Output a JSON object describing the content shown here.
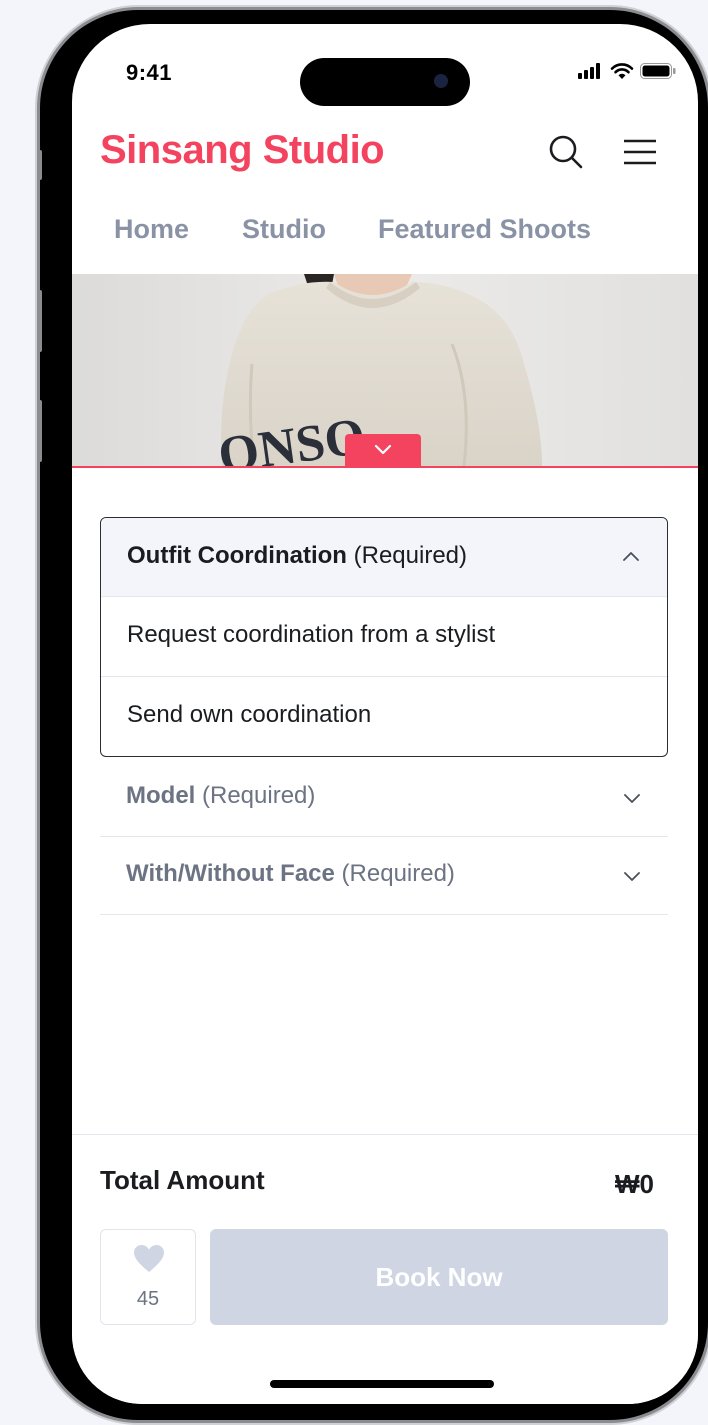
{
  "status_bar": {
    "time": "9:41"
  },
  "header": {
    "brand": "Sinsang Studio",
    "brand_color": "#f4435e",
    "search_icon": "search-icon",
    "menu_icon": "hamburger-menu-icon"
  },
  "nav": {
    "items": [
      {
        "label": "Home"
      },
      {
        "label": "Studio"
      },
      {
        "label": "Featured Shoots"
      }
    ]
  },
  "hero": {
    "toggle_icon": "chevron-down-icon",
    "sweatshirt_text": "ONSO"
  },
  "options": {
    "outfit": {
      "title": "Outfit Coordination",
      "suffix": "(Required)",
      "expanded": true,
      "choices": [
        {
          "label": "Request coordination from a stylist"
        },
        {
          "label": "Send own coordination"
        }
      ]
    },
    "model": {
      "title": "Model",
      "suffix": "(Required)",
      "expanded": false
    },
    "face": {
      "title": "With/Without Face",
      "suffix": "(Required)",
      "expanded": false
    }
  },
  "footer": {
    "total_label": "Total Amount",
    "total_value": "₩0",
    "like_count": "45",
    "book_label": "Book Now",
    "book_disabled_color": "#cfd5e2"
  }
}
